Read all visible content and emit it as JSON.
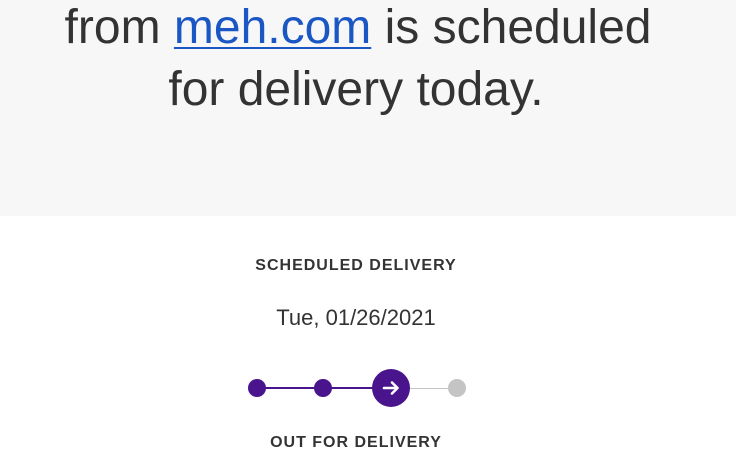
{
  "hero": {
    "line1_prefix": "from ",
    "sender_link": "meh.com",
    "line1_suffix": " is scheduled",
    "line2": "for delivery today."
  },
  "delivery": {
    "label": "SCHEDULED DELIVERY",
    "date": "Tue, 01/26/2021"
  },
  "progress": {
    "steps_completed": 2,
    "current_step": 3,
    "total_steps": 4,
    "status_label": "OUT FOR DELIVERY"
  },
  "colors": {
    "hero_background": "#f7f7f7",
    "link": "#1a56c4",
    "progress_active": "#4a148c",
    "progress_inactive": "#c4c4c4"
  },
  "icons": {
    "current_step": "arrow-right-icon"
  }
}
